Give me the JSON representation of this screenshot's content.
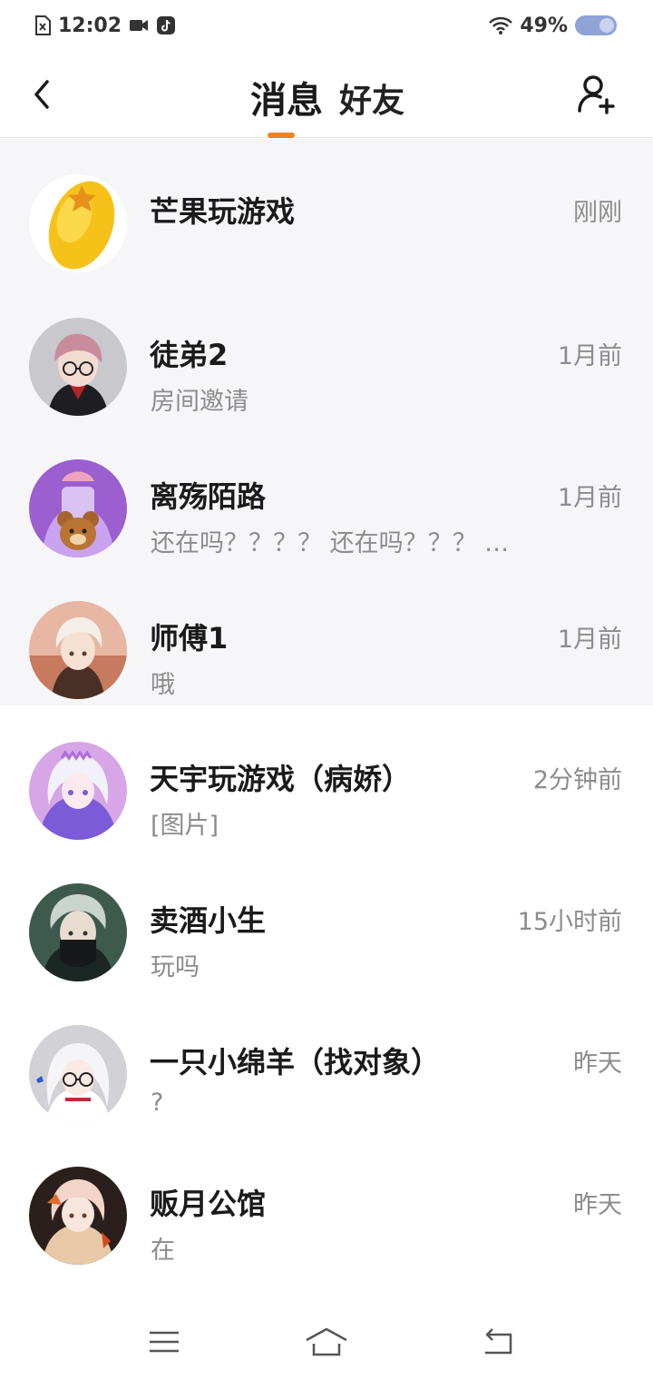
{
  "status_bar": {
    "time": "12:02",
    "battery": "49%"
  },
  "header": {
    "tabs": [
      {
        "label": "消息",
        "active": true
      },
      {
        "label": "好友",
        "active": false
      }
    ],
    "accent_color": "#f08225",
    "back_icon": "chevron-left-icon",
    "add_friend_icon": "add-user-icon"
  },
  "conversations": [
    {
      "name": "芒果玩游戏",
      "time": "刚刚",
      "preview": "",
      "pinned": true,
      "avatar": "mango-avatar"
    },
    {
      "name": "徒弟2",
      "time": "1月前",
      "preview": "房间邀请",
      "pinned": true,
      "avatar": "glasses-boy-avatar"
    },
    {
      "name": "离殇陌路",
      "time": "1月前",
      "preview": "还在吗？？？？ 还在吗？？？ …",
      "pinned": true,
      "avatar": "purple-bear-avatar"
    },
    {
      "name": "师傅1",
      "time": "1月前",
      "preview": "哦",
      "pinned": true,
      "avatar": "white-hair-boy-avatar"
    },
    {
      "name": "天宇玩游戏（病娇）",
      "time": "2分钟前",
      "preview": "[图片]",
      "pinned": false,
      "avatar": "pink-anime-girl-avatar"
    },
    {
      "name": "卖酒小生",
      "time": "15小时前",
      "preview": "玩吗",
      "pinned": false,
      "avatar": "masked-ninja-avatar"
    },
    {
      "name": "一只小绵羊（找对象）",
      "time": "昨天",
      "preview": "?",
      "pinned": false,
      "avatar": "glasses-girl-avatar"
    },
    {
      "name": "贩月公馆",
      "time": "昨天",
      "preview": "在",
      "pinned": false,
      "avatar": "orange-hair-avatar"
    }
  ],
  "system_nav": {
    "menu_icon": "menu-icon",
    "home_icon": "home-icon",
    "back_icon": "back-icon"
  }
}
